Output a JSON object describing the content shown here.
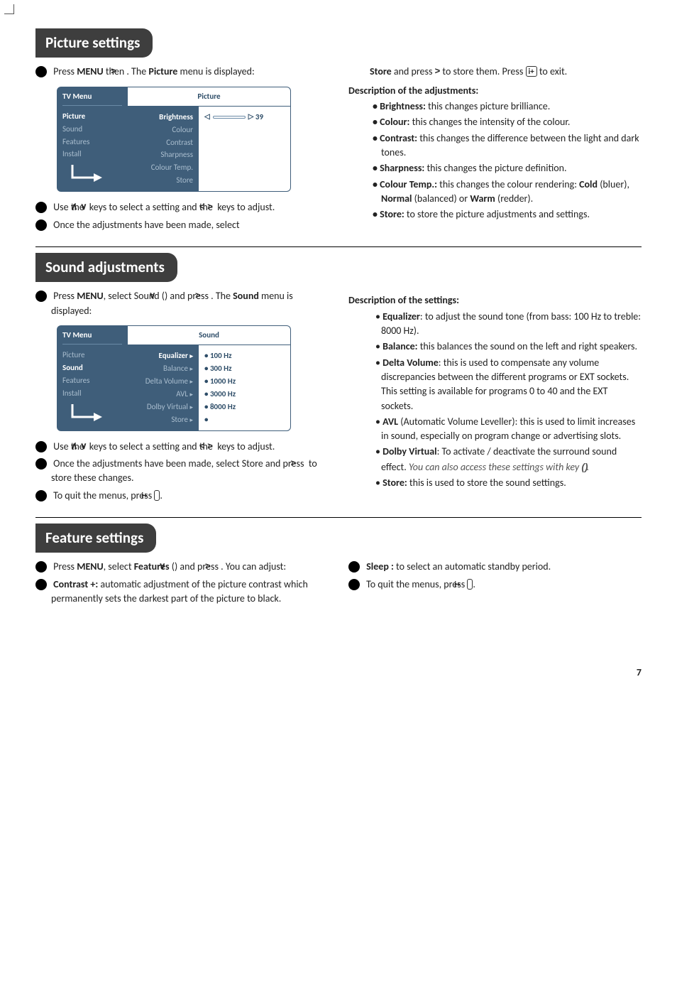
{
  "cropmark": true,
  "picture": {
    "heading": "Picture settings",
    "step1a": "Press",
    "step1b": "MENU",
    "step1c": "then",
    "step1d": ". The",
    "step1e": "Picture",
    "step1f": "menu is displayed:",
    "panel": {
      "tvMenu": "TV Menu",
      "title": "Picture",
      "leftItems": [
        "Picture",
        "Sound",
        "Features",
        "Install"
      ],
      "leftSel": 0,
      "rightItems": [
        "Brightness",
        "Colour",
        "Contrast",
        "Sharpness",
        "Colour Temp.",
        "Store"
      ],
      "rightSel": 0,
      "sliderVal": "39"
    },
    "step2a": "Use the",
    "step2b": "keys to select a setting and the",
    "step2c": "keys to adjust.",
    "step3": "Once the adjustments have been made, select",
    "right_top_a": "Store",
    "right_top_b": "and press",
    "right_top_c": "to store them. Press",
    "right_top_d": "to exit.",
    "descHead": "Description of the adjustments:",
    "b_bright_h": "• Brightness:",
    "b_bright_t": "this changes picture brilliance.",
    "b_col_h": "• Colour:",
    "b_col_t": "this changes the intensity of the colour.",
    "b_con_h": "• Contrast:",
    "b_con_t": "this changes the difference between the light and dark tones.",
    "b_sha_h": "• Sharpness:",
    "b_sha_t": "this changes the picture definition.",
    "b_ct_h": "• Colour Temp.:",
    "b_ct_t1": "this changes the colour rendering:",
    "b_ct_cold": "Cold",
    "b_ct_t2": "(bluer),",
    "b_ct_norm": "Normal",
    "b_ct_t3": "(balanced) or",
    "b_ct_warm": "Warm",
    "b_ct_t4": "(redder).",
    "b_st_h": "• Store:",
    "b_st_t": "to store the picture adjustments and settings."
  },
  "sound": {
    "heading": "Sound adjustments",
    "step1a": "Press",
    "step1b": "MENU",
    "step1c": ", select Sound (",
    "step1d": ") and press",
    "step1e": ". The",
    "step1f": "Sound",
    "step1g": "menu is displayed:",
    "panel": {
      "tvMenu": "TV Menu",
      "title": "Sound",
      "leftItems": [
        "Picture",
        "Sound",
        "Features",
        "Install"
      ],
      "leftSel": 1,
      "rightItems": [
        "Equalizer",
        "Balance",
        "Delta Volume",
        "AVL",
        "Dolby Virtual",
        "Store"
      ],
      "rightVals": [
        "•   100 Hz",
        "•   300 Hz",
        "•   1000 Hz",
        "•   3000 Hz",
        "•   8000 Hz",
        "• "
      ],
      "rightSel": 0
    },
    "step2a": "Use the",
    "step2b": "keys to select a setting and the",
    "step2c": "keys to adjust.",
    "step3a": "Once the adjustments have been made, select Store and press",
    "step3b": "to store these changes.",
    "step4a": "To quit the menus, press",
    "descHead": "Description of the settings:",
    "eq_h": "Equalizer",
    "eq_t": ": to adjust the sound tone (from bass: 100 Hz to treble: 8000 Hz).",
    "bal_h": "Balance:",
    "bal_t": "this balances the sound on the left and right speakers.",
    "dv_h": "Delta Volume",
    "dv_t": ": this is used to compensate any volume discrepancies between the different programs or EXT sockets. This setting is available for programs 0 to 40 and the EXT sockets.",
    "avl_h": "AVL",
    "avl_t": "(Automatic Volume Leveller): this is used to limit increases in sound, especially on program change or advertising slots.",
    "dby_h": "Dolby Virtual",
    "dby_t1": ": To activate / deactivate the surround sound effect.",
    "dby_i": "You can also access these settings with key",
    "st_h": "Store:",
    "st_t": "this is used to store the sound settings."
  },
  "feature": {
    "heading": "Feature settings",
    "s1a": "Press",
    "s1b": "MENU",
    "s1c": ", select",
    "s1d": "Features",
    "s1e": "(",
    "s1f": ") and press",
    "s1g": ". You can adjust:",
    "s2h": "Contrast +:",
    "s2t": "automatic adjustment of the picture contrast which permanently sets the darkest part of the picture to black.",
    "s3h": "Sleep :",
    "s3t": "to select an automatic standby period.",
    "s4a": "To quit the menus, press"
  },
  "pageNum": "7"
}
